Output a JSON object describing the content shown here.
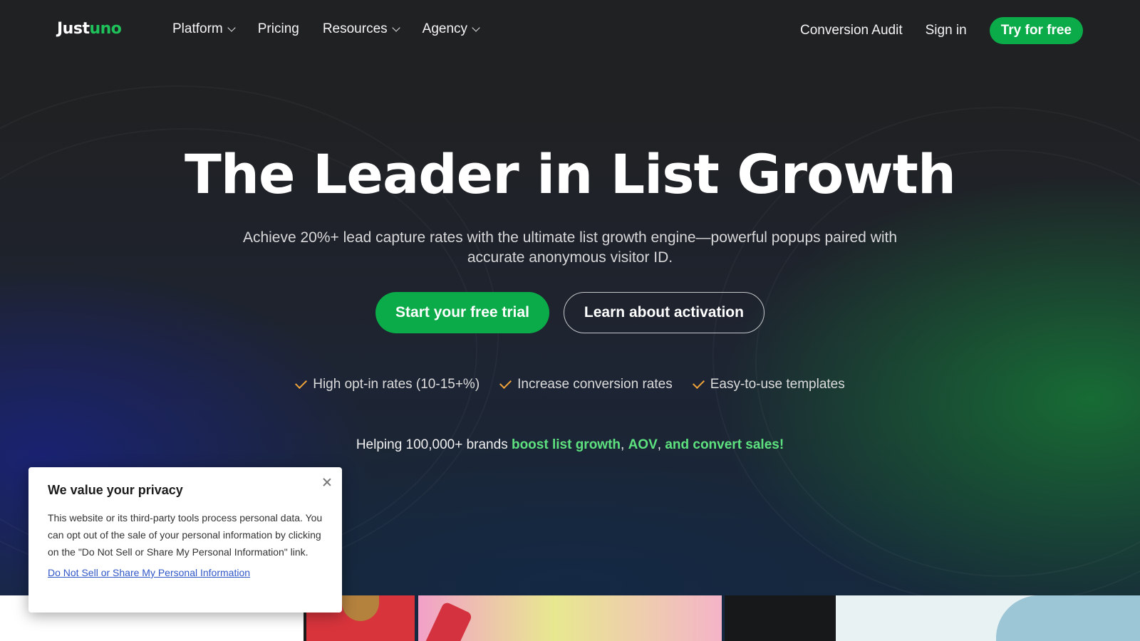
{
  "brand": {
    "logo_part1": "Just",
    "logo_part2": "uno"
  },
  "nav": {
    "items": [
      {
        "label": "Platform",
        "has_dropdown": true
      },
      {
        "label": "Pricing",
        "has_dropdown": false
      },
      {
        "label": "Resources",
        "has_dropdown": true
      },
      {
        "label": "Agency",
        "has_dropdown": true
      }
    ],
    "conversion_audit": "Conversion Audit",
    "sign_in": "Sign in",
    "try_free": "Try for free"
  },
  "hero": {
    "title": "The Leader in List Growth",
    "subtitle": "Achieve 20%+ lead capture rates with the ultimate list growth engine—powerful popups paired with accurate anonymous visitor ID.",
    "cta_primary": "Start your free trial",
    "cta_secondary": "Learn about activation",
    "features": [
      "High opt-in rates (10-15+%)",
      "Increase conversion rates",
      "Easy-to-use templates"
    ],
    "tagline_prefix": "Helping 100,000+ brands ",
    "tagline_hl1": "boost list growth",
    "tagline_sep1": ", ",
    "tagline_hl2": "AOV",
    "tagline_sep2": ", ",
    "tagline_hl3": "and convert sales!"
  },
  "cookie": {
    "title": "We value your privacy",
    "body": "This website or its third-party tools process personal data. You can opt out of the sale of your personal information by clicking on the \"Do Not Sell or Share My Personal Information\" link.",
    "link": "Do Not Sell or Share My Personal Information"
  },
  "colors": {
    "accent_green": "#0bab49",
    "highlight_green": "#5ee27f",
    "check_orange": "#f0a43a",
    "background": "#202123"
  },
  "icons": [
    "chevron-down-icon",
    "check-icon",
    "close-icon"
  ]
}
